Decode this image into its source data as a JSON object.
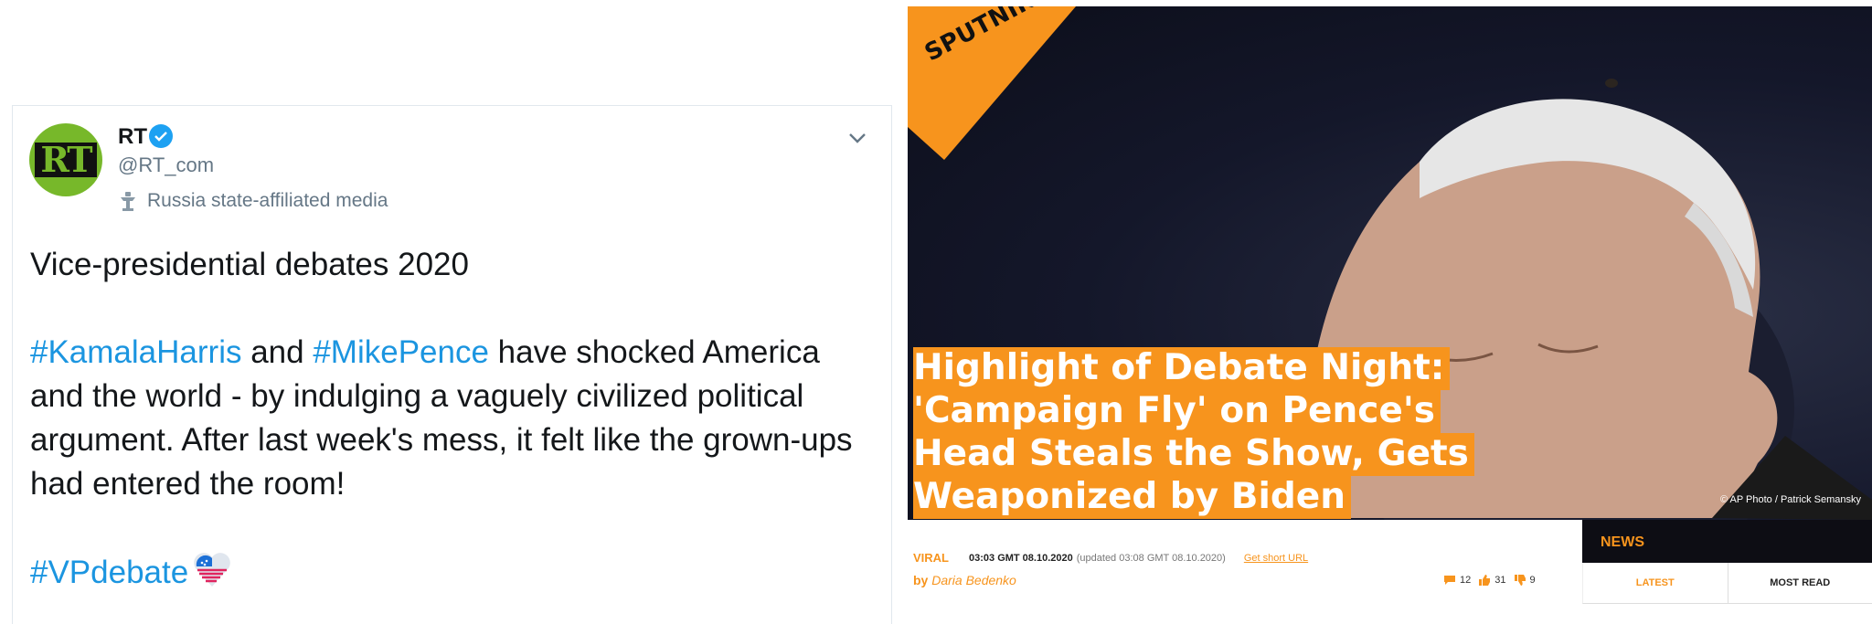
{
  "tweet": {
    "display_name": "RT",
    "handle": "@RT_com",
    "label": "Russia state-affiliated media",
    "avatar_text": "RT",
    "line1": "Vice-presidential debates 2020",
    "hashtag1": "#KamalaHarris",
    "and_word": " and ",
    "hashtag2": "#MikePence",
    "line2_rest": " have shocked America and the world - by indulging a vaguely civilized political argument. After last week's mess, it felt like the grown-ups had entered the room!",
    "hashtag3": "#VPdebate",
    "link_color": "#1b95e0",
    "verified_color": "#1da1f2"
  },
  "sputnik": {
    "brand": "SPUTNIK",
    "brand_color": "#f7941d",
    "headline": [
      "Highlight of Debate Night:",
      "'Campaign Fly' on Pence's",
      "Head Steals the Show, Gets",
      "Weaponized by Biden"
    ],
    "photo_credit": "© AP Photo / Patrick Semansky",
    "category": "VIRAL",
    "time": "03:03 GMT 08.10.2020",
    "updated": "(updated 03:08 GMT 08.10.2020)",
    "short_url": "Get short URL",
    "by": "by",
    "author": "Daria Bedenko",
    "stats": {
      "comments": "12",
      "likes": "31",
      "dislikes": "9"
    },
    "news_panel": {
      "title": "NEWS",
      "tabs": [
        "LATEST",
        "MOST READ"
      ]
    }
  }
}
